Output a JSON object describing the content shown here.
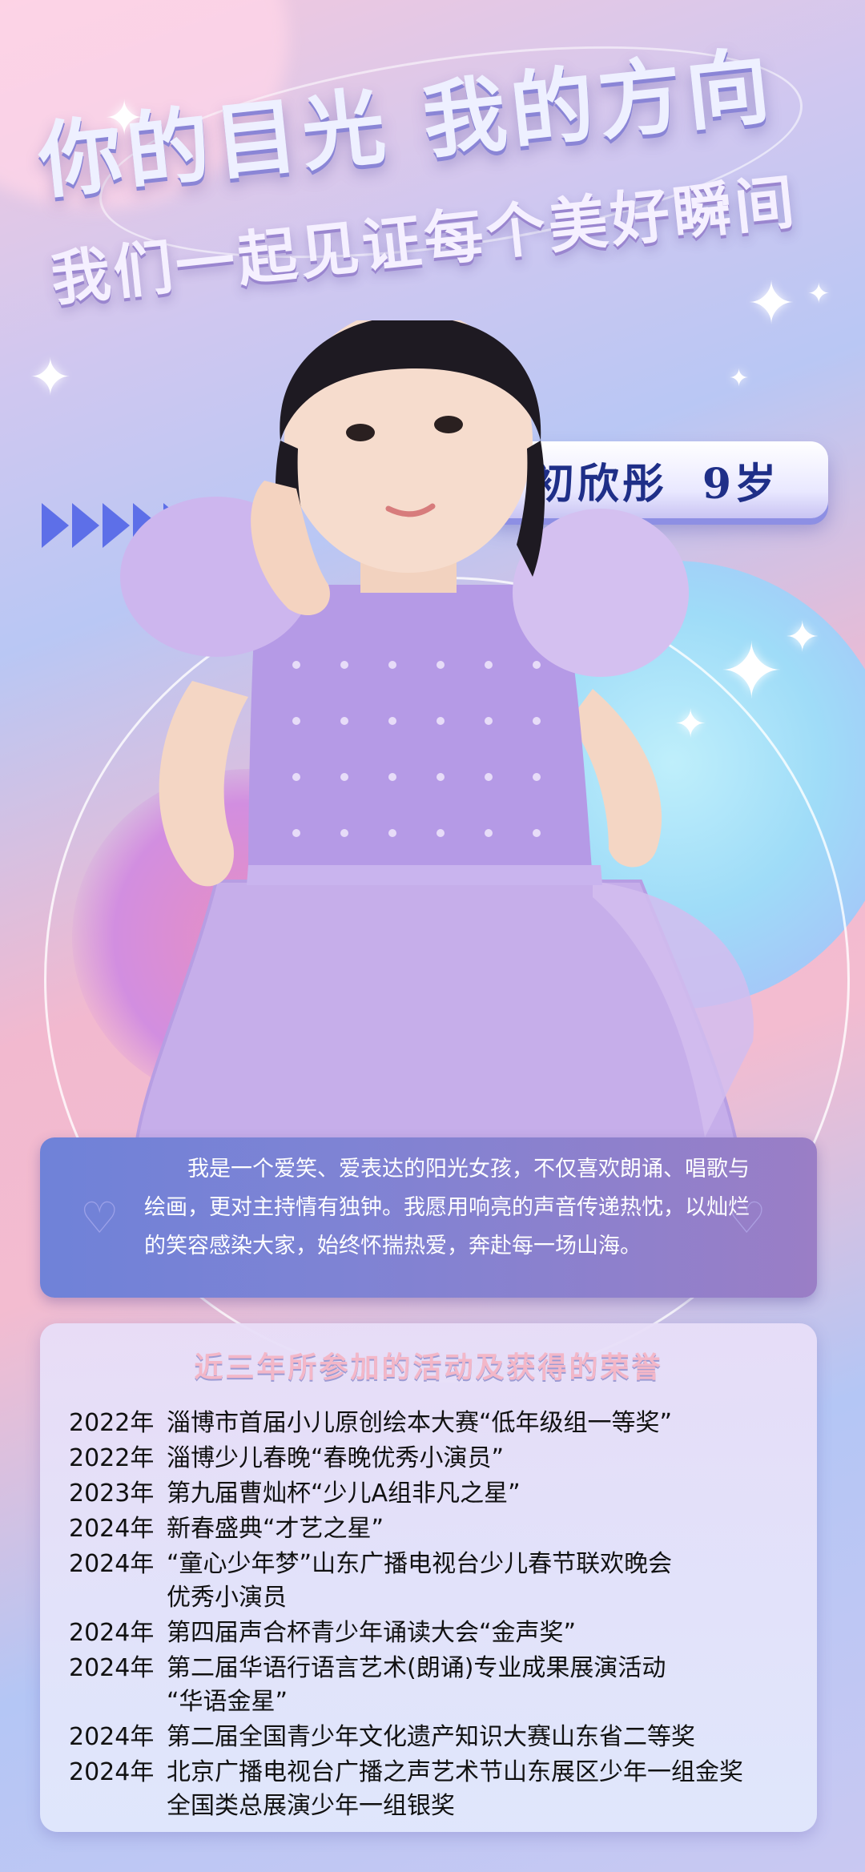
{
  "header": {
    "title_line1": "你的目光 我的方向",
    "title_line2": "我们一起见证每个美好瞬间"
  },
  "profile": {
    "name": "初欣彤",
    "age": "9岁"
  },
  "intro": {
    "text": "我是一个爱笑、爱表达的阳光女孩，不仅喜欢朗诵、唱歌与绘画，更对主持情有独钟。我愿用响亮的声音传递热忱，以灿烂的笑容感染大家，始终怀揣热爱，奔赴每一场山海。"
  },
  "honors": {
    "title": "近三年所参加的活动及获得的荣誉",
    "items": [
      {
        "year": "2022年",
        "text": "淄博市首届小儿原创绘本大赛“低年级组一等奖”"
      },
      {
        "year": "2022年",
        "text": "淄博少儿春晚“春晚优秀小演员”"
      },
      {
        "year": "2023年",
        "text": "第九届曹灿杯“少儿A组非凡之星”"
      },
      {
        "year": "2024年",
        "text": "新春盛典“才艺之星”"
      },
      {
        "year": "2024年",
        "text": "“童心少年梦”山东广播电视台少儿春节联欢晚会",
        "cont": "优秀小演员"
      },
      {
        "year": "2024年",
        "text": "第四届声合杯青少年诵读大会“金声奖”"
      },
      {
        "year": "2024年",
        "text": "第二届华语行语言艺术(朗诵)专业成果展演活动",
        "cont": "“华语金星”"
      },
      {
        "year": "2024年",
        "text": "第二届全国青少年文化遗产知识大赛山东省二等奖"
      },
      {
        "year": "2024年",
        "text": "北京广播电视台广播之声艺术节山东展区少年一组金奖",
        "cont": "全国类总展演少年一组银奖"
      }
    ]
  },
  "colors": {
    "accent_blue": "#5d6fe8",
    "name_text": "#1f2f88",
    "dress_purple": "#b59ae6"
  },
  "icons": [
    "sparkle-star-icon",
    "arrow-right-icon",
    "heart-icon"
  ]
}
